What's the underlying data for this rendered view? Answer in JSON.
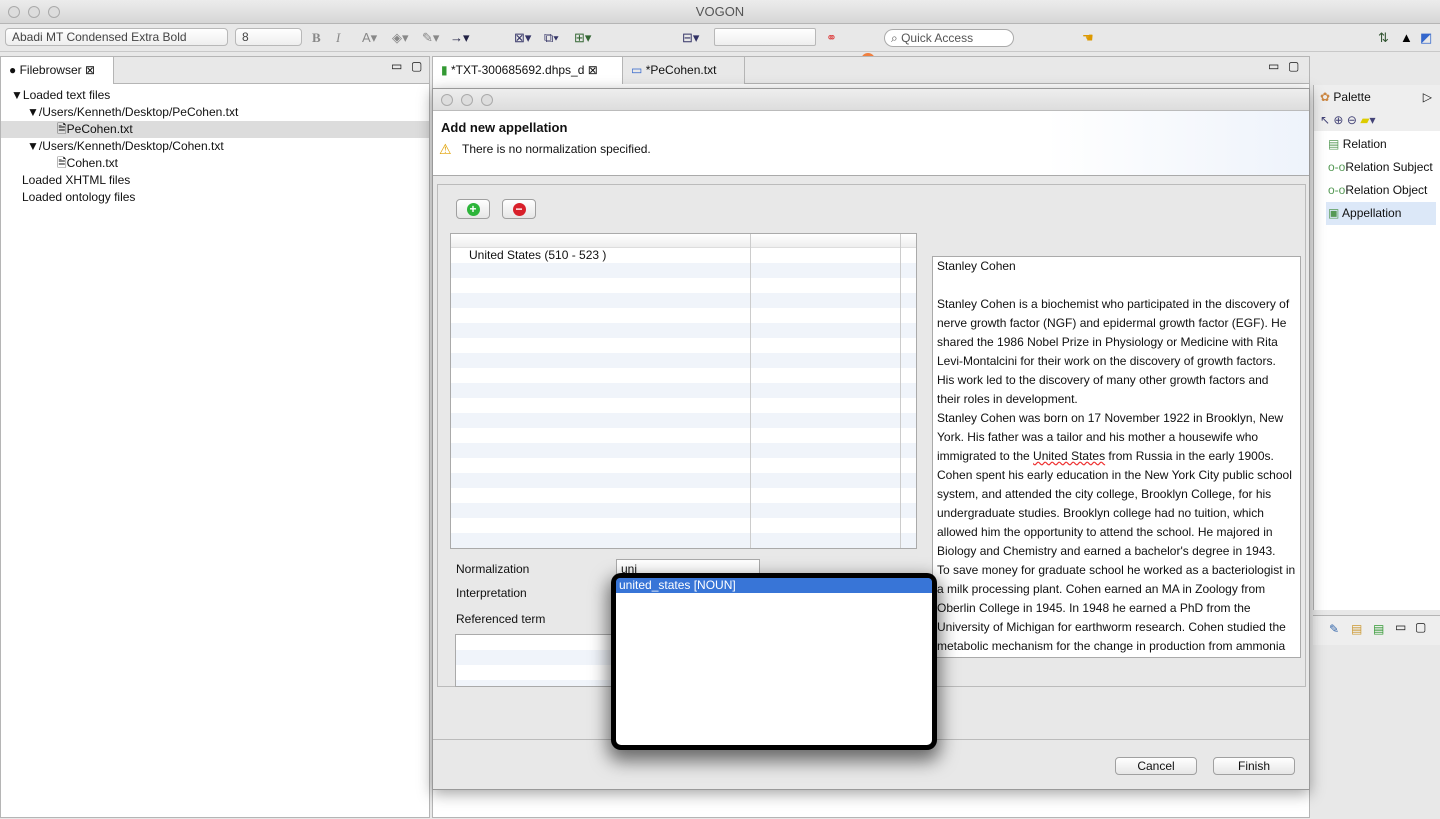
{
  "window": {
    "title": "VOGON"
  },
  "toolbar": {
    "font_name": "Abadi MT Condensed Extra Bold",
    "font_size": "8",
    "bold": "B",
    "italic": "I",
    "quick_access_placeholder": "Quick Access"
  },
  "filebrowser": {
    "tab_label": "Filebrowser",
    "items": [
      "Loaded text files",
      "/Users/Kenneth/Desktop/PeCohen.txt",
      "PeCohen.txt",
      "/Users/Kenneth/Desktop/Cohen.txt",
      "Cohen.txt",
      "Loaded XHTML files",
      "Loaded ontology files"
    ]
  },
  "editor": {
    "tabs": [
      {
        "label": "*TXT-300685692.dhps_d"
      },
      {
        "label": "*PeCohen.txt"
      }
    ]
  },
  "palette": {
    "title": "Palette",
    "items": [
      "Relation",
      "Relation Subject",
      "Relation Object",
      "Appellation"
    ],
    "selected": "Appellation"
  },
  "dialog": {
    "title": "Add new appellation",
    "warning": "There is no normalization specified.",
    "table_rows": [
      "United States (510 - 523 )"
    ],
    "labels": {
      "normalization": "Normalization",
      "interpretation": "Interpretation",
      "referenced_term": "Referenced term"
    },
    "normalization_value": "uni",
    "suggestions": [
      "united_states [NOUN]"
    ],
    "cancel": "Cancel",
    "finish": "Finish",
    "text_lines": [
      "Stanley Cohen",
      "",
      "Stanley Cohen is a biochemist who participated in the discovery of",
      "nerve growth factor (NGF) and epidermal growth factor (EGF).  He",
      "shared the 1986 Nobel Prize in Physiology or Medicine with Rita",
      "Levi-Montalcini for their work on the discovery of growth factors.",
      "His work led to the discovery of many other growth factors and",
      "their roles in development.",
      "Stanley Cohen was born on 17 November 1922 in Brooklyn, New",
      "York.  His father was a tailor and his mother a housewife who",
      "immigrated to the United States from Russia in the early 1900s.",
      "Cohen spent his early education in the New York City public school",
      "system, and attended the city college, Brooklyn College, for his",
      "undergraduate studies.  Brooklyn college had no tuition, which",
      "allowed him the opportunity to attend the school.   He majored in",
      "Biology and Chemistry and earned a bachelor's degree in 1943.",
      "To save money for graduate school he worked as a bacteriologist in",
      "a milk processing plant.  Cohen earned an MA in Zoology from",
      "Oberlin College in 1945.  In 1948 he earned a PhD from the",
      "University of Michigan for earthworm research.  Cohen studied the",
      "metabolic mechanism for the change in production from ammonia"
    ]
  },
  "colors": {
    "selection": "#3875d7",
    "palette_selected": "#dce8f8",
    "add": "#2db53a",
    "remove": "#d8202a"
  }
}
